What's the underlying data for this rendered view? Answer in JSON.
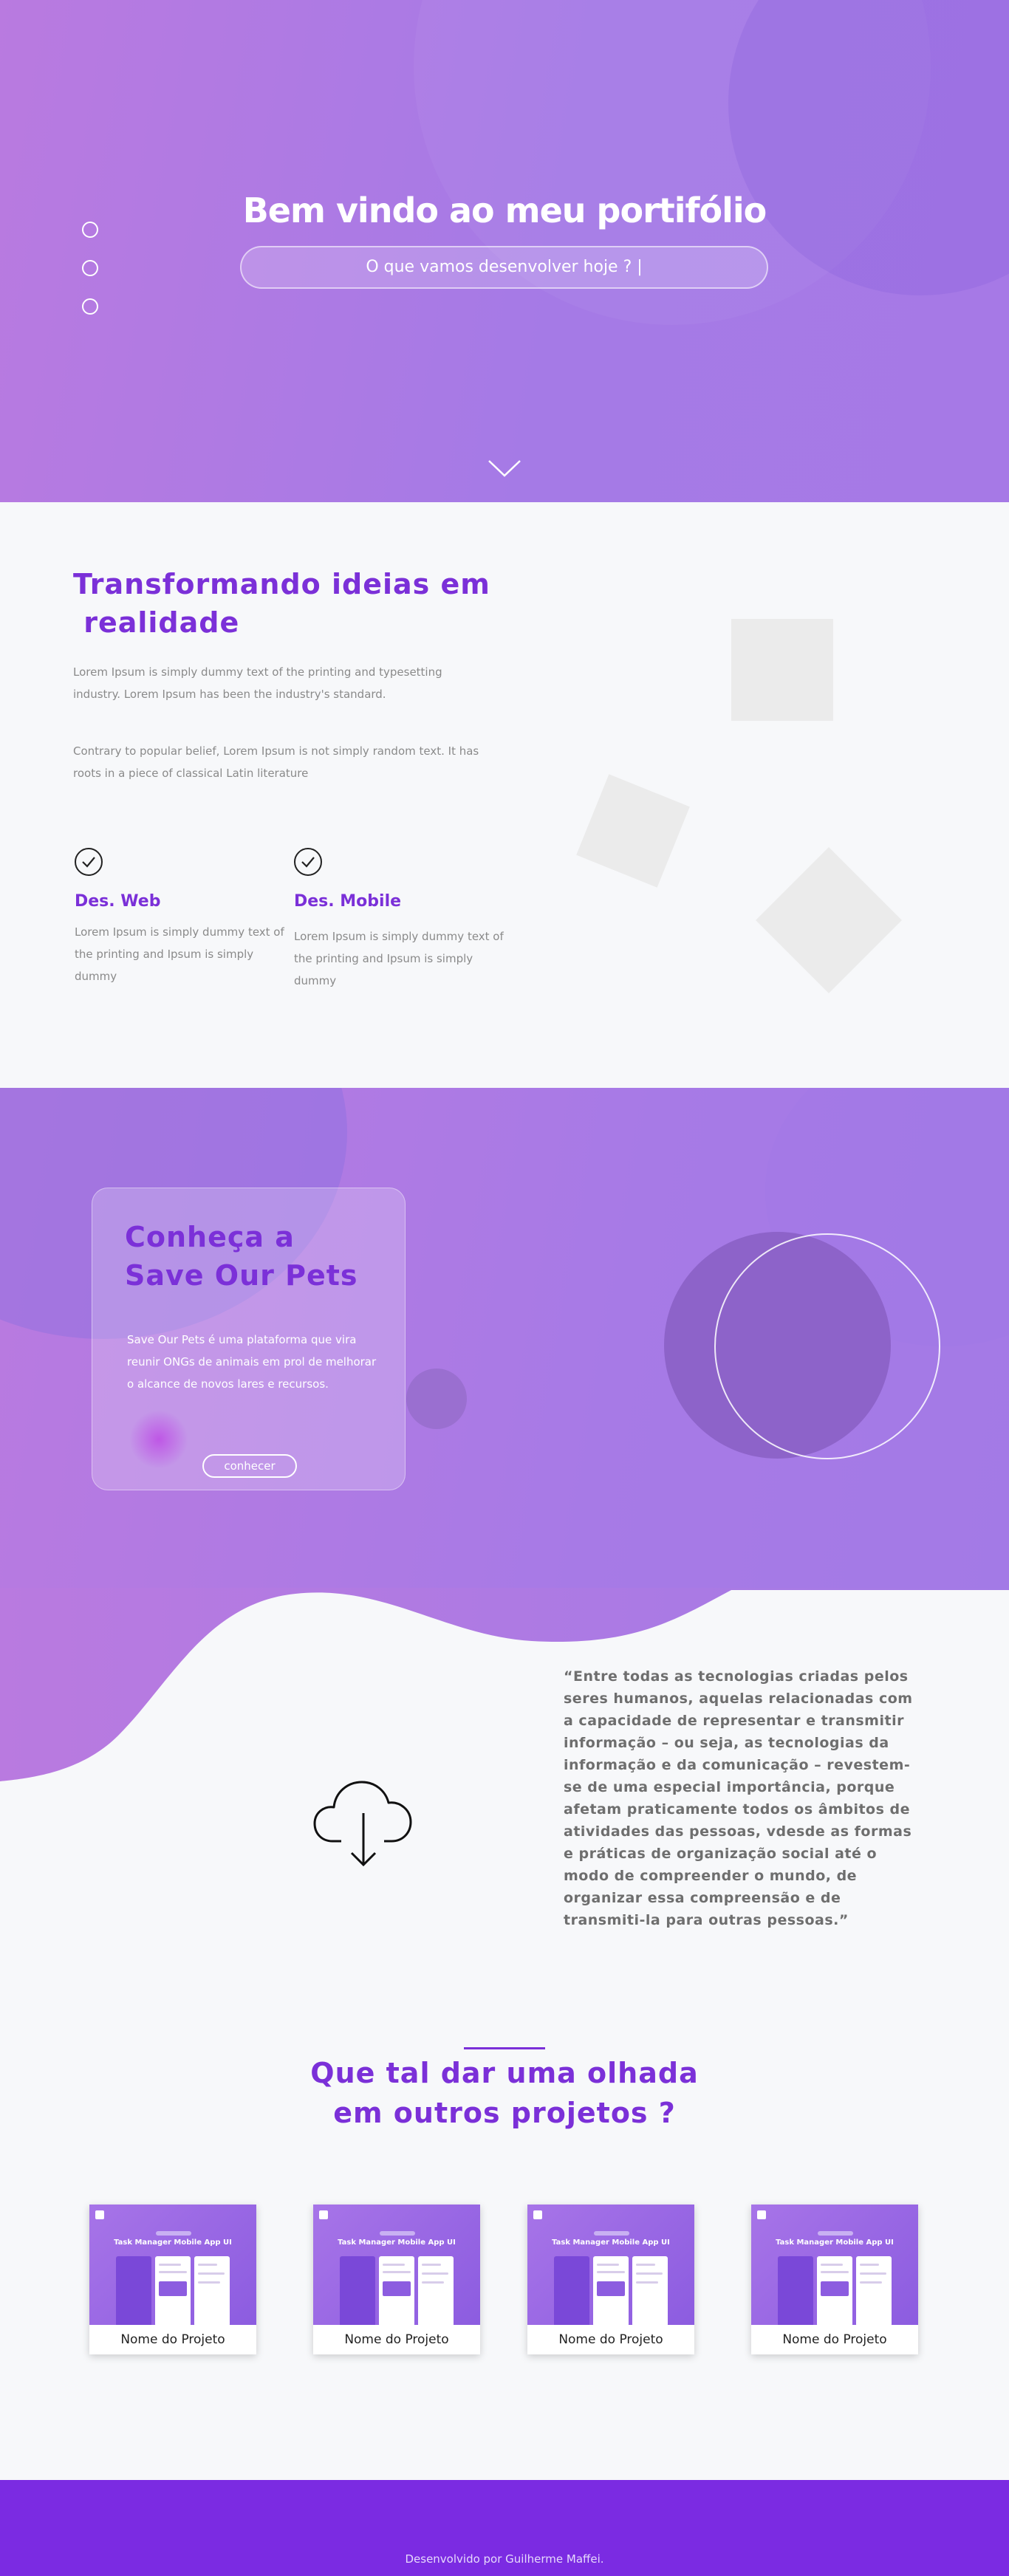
{
  "hero": {
    "title": "Bem vindo ao meu portifólio",
    "search_text": "O que vamos desenvolver hoje ? |",
    "nav_dots": 3
  },
  "about": {
    "title": "Transformando ideias em\n realidade",
    "paragraph1": "Lorem Ipsum is simply dummy text of the printing and typesetting industry. Lorem Ipsum has been the industry's standard.",
    "paragraph2": "Contrary to popular belief, Lorem Ipsum is not simply random text. It has roots in a piece of classical Latin literature",
    "skills": [
      {
        "title": "Des. Web",
        "text": "Lorem Ipsum is simply dummy text of the printing and Ipsum is simply dummy",
        "icon": "check-circle-icon"
      },
      {
        "title": "Des. Mobile",
        "text": "Lorem Ipsum is simply dummy text of the printing and Ipsum is simply dummy",
        "icon": "check-circle-icon"
      }
    ]
  },
  "pets": {
    "title": "Conheça a\nSave Our Pets",
    "text": "Save Our Pets é uma plataforma que vira reunir ONGs de animais em prol de melhorar o alcance de novos lares e recursos.",
    "button_label": "conhecer"
  },
  "quote": {
    "text": "“Entre todas as tecnologias criadas pelos seres humanos, aquelas relacionadas com a capacidade de representar e transmitir informação – ou seja, as tecnologias da informação e da comunicação – revestem-se de uma especial importância, porque afetam praticamente todos os âmbitos de atividades das pessoas, vdesde as formas e práticas de organização social até o modo de compreender o mundo, de organizar essa compreensão e de transmiti-la para outras pessoas.”",
    "icon": "cloud-download-icon"
  },
  "projects": {
    "title": "Que tal dar uma olhada\nem outros projetos ?",
    "thumb_title": "Task Manager Mobile App UI",
    "items": [
      {
        "name": "Nome do Projeto"
      },
      {
        "name": "Nome do Projeto"
      },
      {
        "name": "Nome do Projeto"
      },
      {
        "name": "Nome do Projeto"
      }
    ]
  },
  "footer": {
    "text": "Desenvolvido por Guilherme Maffei."
  },
  "colors": {
    "accent": "#7b30d8",
    "hero_gradient_start": "#b97ae0",
    "hero_gradient_end": "#a679e6",
    "footer_bg": "#7b2be2"
  }
}
